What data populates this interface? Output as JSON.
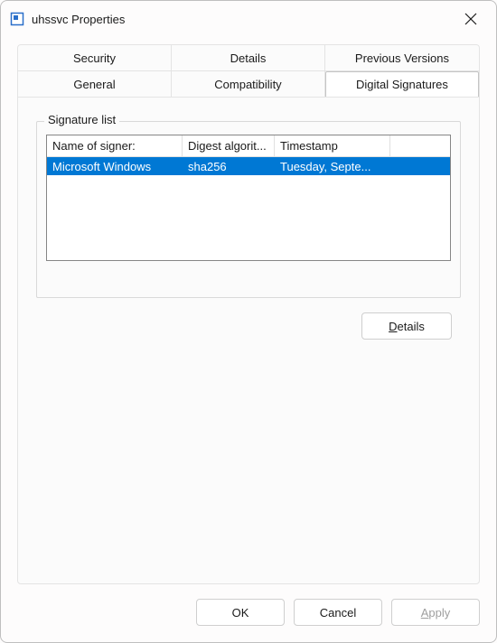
{
  "window": {
    "title": "uhssvc Properties"
  },
  "tabs": {
    "security": "Security",
    "details": "Details",
    "previous_versions": "Previous Versions",
    "general": "General",
    "compatibility": "Compatibility",
    "digital_signatures": "Digital Signatures"
  },
  "signature_list": {
    "groupbox_label": "Signature list",
    "columns": {
      "signer": "Name of signer:",
      "digest": "Digest algorit...",
      "timestamp": "Timestamp"
    },
    "rows": [
      {
        "signer": "Microsoft Windows",
        "digest": "sha256",
        "timestamp": "Tuesday, Septe..."
      }
    ],
    "details_button": "Details"
  },
  "dialog_buttons": {
    "ok": "OK",
    "cancel": "Cancel",
    "apply": "Apply"
  }
}
